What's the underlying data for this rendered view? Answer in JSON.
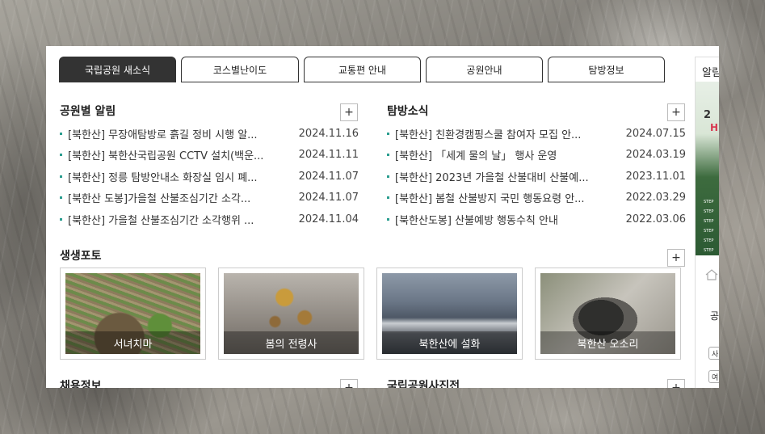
{
  "tabs": [
    {
      "label": "국립공원 새소식",
      "active": true
    },
    {
      "label": "코스별난이도",
      "active": false
    },
    {
      "label": "교통편 안내",
      "active": false
    },
    {
      "label": "공원안내",
      "active": false
    },
    {
      "label": "탐방정보",
      "active": false
    }
  ],
  "park_notices": {
    "title": "공원별 알림",
    "more": "+",
    "items": [
      {
        "title": "[북한산] 무장애탐방로 흙길 정비 시행 알...",
        "date": "2024.11.16"
      },
      {
        "title": "[북한산] 북한산국립공원 CCTV 설치(백운...",
        "date": "2024.11.11"
      },
      {
        "title": "[북한산] 정릉 탐방안내소 화장실 임시 폐...",
        "date": "2024.11.07"
      },
      {
        "title": "[북한산 도봉]가을철 산불조심기간 소각...",
        "date": "2024.11.07"
      },
      {
        "title": "[북한산] 가을철 산불조심기간 소각행위 ...",
        "date": "2024.11.04"
      }
    ]
  },
  "visit_news": {
    "title": "탐방소식",
    "more": "+",
    "items": [
      {
        "title": "[북한산] 친환경캠핑스쿨 참여자 모집 안...",
        "date": "2024.07.15"
      },
      {
        "title": "[북한산] 「세계 물의 날」 행사 운영",
        "date": "2024.03.19"
      },
      {
        "title": "[북한산] 2023년 가을철 산불대비 산불예...",
        "date": "2023.11.01"
      },
      {
        "title": "[북한산] 봄철 산불방지 국민 행동요령 안...",
        "date": "2022.03.29"
      },
      {
        "title": "[북한산도봉] 산불예방 행동수칙 안내",
        "date": "2022.03.06"
      }
    ]
  },
  "photos": {
    "title": "생생포토",
    "more": "+",
    "items": [
      {
        "caption": "서녀치마"
      },
      {
        "caption": "봄의 전령사"
      },
      {
        "caption": "북한산에 설화"
      },
      {
        "caption": "북한산 오소리"
      }
    ]
  },
  "jobs": {
    "title": "채용정보",
    "more": "+"
  },
  "photo_contest": {
    "title": "국립공원사진전",
    "more": "+"
  },
  "side": {
    "label": "알림",
    "banner_big1": "2",
    "banner_big2": "H",
    "steps": [
      "STEP",
      "STEP",
      "STEP",
      "STEP",
      "STEP",
      "STEP"
    ],
    "b2": "공",
    "pill1": "사",
    "pill2": "여"
  },
  "colors": {
    "accent": "#2a9d8f",
    "tab_active": "#333333"
  }
}
